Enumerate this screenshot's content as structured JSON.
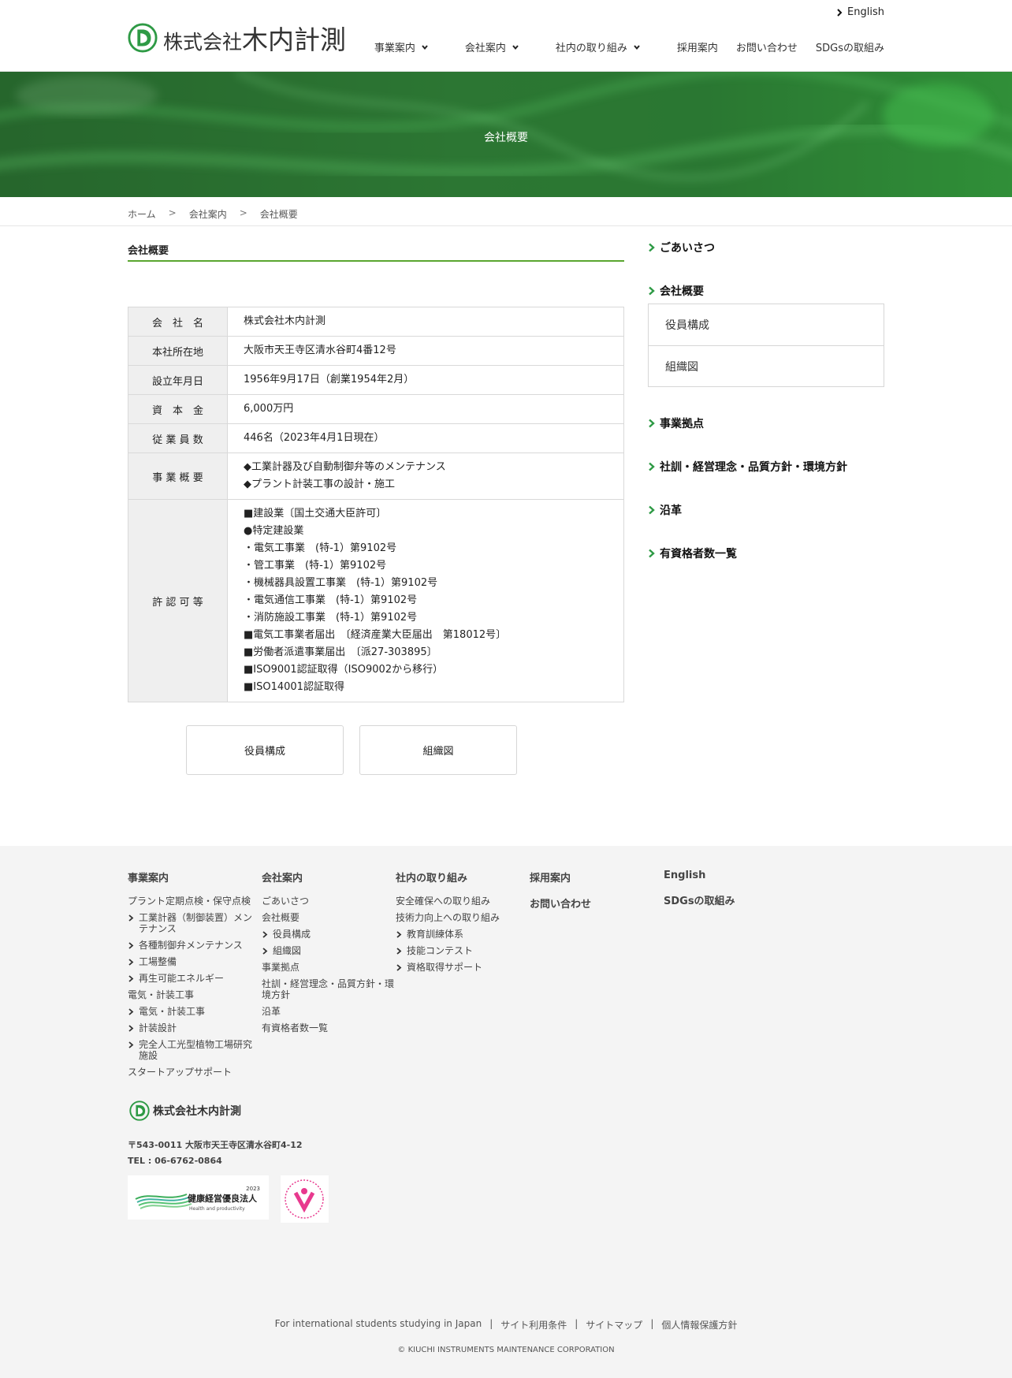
{
  "header": {
    "logo_prefix": "株式会社",
    "logo_name": "木内計測",
    "lang_link": "English",
    "nav": [
      {
        "label": "事業案内",
        "dropdown": true
      },
      {
        "label": "会社案内",
        "dropdown": true
      },
      {
        "label": "社内の取り組み",
        "dropdown": true
      },
      {
        "label": "採用案内",
        "dropdown": false
      },
      {
        "label": "お問い合わせ",
        "dropdown": false
      },
      {
        "label": "SDGsの取組み",
        "dropdown": false
      }
    ]
  },
  "hero": {
    "title": "会社概要"
  },
  "breadcrumb": {
    "items": [
      "ホーム",
      "会社案内",
      "会社概要"
    ],
    "separator": ">"
  },
  "main": {
    "section_title": "会社概要",
    "table": [
      {
        "label": "会　社　名",
        "lines": [
          "株式会社木内計測"
        ]
      },
      {
        "label": "本社所在地",
        "lines": [
          "大阪市天王寺区清水谷町4番12号"
        ]
      },
      {
        "label": "設立年月日",
        "lines": [
          "1956年9月17日（創業1954年2月）"
        ]
      },
      {
        "label": "資　本　金",
        "lines": [
          "6,000万円"
        ]
      },
      {
        "label": "従 業 員 数",
        "lines": [
          "446名（2023年4月1日現在）"
        ]
      },
      {
        "label": "事 業 概 要",
        "lines": [
          "◆工業計器及び自動制御弁等のメンテナンス",
          "◆プラント計装工事の設計・施工"
        ]
      },
      {
        "label": "許 認 可 等",
        "lines": [
          "■建設業〔国土交通大臣許可〕",
          "●特定建設業",
          "・電気工事業　(特-1）第9102号",
          "・管工事業　(特-1）第9102号",
          "・機械器具設置工事業　(特-1）第9102号",
          "・電気通信工事業　(特-1）第9102号",
          "・消防施設工事業　(特-1）第9102号",
          "■電気工事業者届出　〔経済産業大臣届出　第18012号〕",
          "■労働者派遣事業届出　〔派27-303895〕",
          "■ISO9001認証取得（ISO9002から移行）",
          "■ISO14001認証取得"
        ]
      }
    ],
    "buttons": [
      "役員構成",
      "組織図"
    ]
  },
  "sidebar": {
    "greeting": "ごあいさつ",
    "overview": "会社概要",
    "overview_sub": [
      "役員構成",
      "組織図"
    ],
    "links": [
      "事業拠点",
      "社訓・経営理念・品質方針・環境方針",
      "沿革",
      "有資格者数一覧"
    ]
  },
  "footer": {
    "col1": {
      "title": "事業案内",
      "items": [
        {
          "label": "プラント定期点検・保守点検",
          "sub": false
        },
        {
          "label": "工業計器（制御装置）メンテナンス",
          "sub": true
        },
        {
          "label": "各種制御弁メンテナンス",
          "sub": true
        },
        {
          "label": "工場整備",
          "sub": true
        },
        {
          "label": "再生可能エネルギー",
          "sub": true
        },
        {
          "label": "電気・計装工事",
          "sub": false
        },
        {
          "label": "電気・計装工事",
          "sub": true
        },
        {
          "label": "計装設計",
          "sub": true
        },
        {
          "label": "完全人工光型植物工場研究施設",
          "sub": true
        },
        {
          "label": "スタートアップサポート",
          "sub": false
        }
      ]
    },
    "col2": {
      "title": "会社案内",
      "items": [
        {
          "label": "ごあいさつ",
          "sub": false
        },
        {
          "label": "会社概要",
          "sub": false
        },
        {
          "label": "役員構成",
          "sub": true
        },
        {
          "label": "組織図",
          "sub": true
        },
        {
          "label": "事業拠点",
          "sub": false
        },
        {
          "label": "社訓・経営理念・品質方針・環境方針",
          "sub": false
        },
        {
          "label": "沿革",
          "sub": false
        },
        {
          "label": "有資格者数一覧",
          "sub": false
        }
      ]
    },
    "col3": {
      "title": "社内の取り組み",
      "items": [
        {
          "label": "安全確保への取り組み",
          "sub": false
        },
        {
          "label": "技術力向上への取り組み",
          "sub": false
        },
        {
          "label": "教育訓練体系",
          "sub": true
        },
        {
          "label": "技能コンテスト",
          "sub": true
        },
        {
          "label": "資格取得サポート",
          "sub": true
        }
      ]
    },
    "col4": {
      "title": "採用案内",
      "title2": "お問い合わせ"
    },
    "col5": {
      "title": "English",
      "title2": "SDGsの取組み"
    },
    "company_name": "株式会社木内計測",
    "address": "〒543-0011 大阪市天王寺区清水谷町4-12",
    "tel": "TEL : 06-6762-0864",
    "banner1_year": "2023",
    "banner1_title": "健康経営優良法人",
    "banner1_sub": "Health and productivity",
    "bottom_links": [
      "For international students studying in Japan",
      "サイト利用条件",
      "サイトマップ",
      "個人情報保護方針"
    ],
    "copyright": "© KIUCHI INSTRUMENTS MAINTENANCE CORPORATION"
  },
  "colors": {
    "brand_green": "#2e9a45",
    "accent_line": "#5aa62f",
    "footer_bg": "#f4f4f4"
  }
}
